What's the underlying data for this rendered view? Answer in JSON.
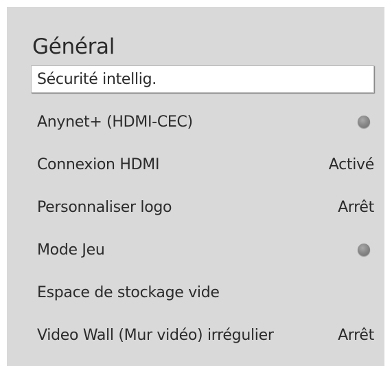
{
  "menu": {
    "title": "Général",
    "items": [
      {
        "label": "Sécurité intellig.",
        "value": ""
      },
      {
        "label": "Anynet+ (HDMI-CEC)",
        "value": ""
      },
      {
        "label": "Connexion HDMI",
        "value": "Activé"
      },
      {
        "label": "Personnaliser logo",
        "value": "Arrêt"
      },
      {
        "label": "Mode Jeu",
        "value": ""
      },
      {
        "label": "Espace de stockage vide",
        "value": ""
      },
      {
        "label": "Video Wall (Mur vidéo) irrégulier",
        "value": "Arrêt"
      }
    ]
  },
  "toggles": {
    "anynet": "off",
    "mode_jeu": "off"
  },
  "colors": {
    "panel_background": "#d9d9d9",
    "selected_background": "#ffffff",
    "text": "#2b2b2b",
    "toggle_off": "#8a8a8a"
  }
}
